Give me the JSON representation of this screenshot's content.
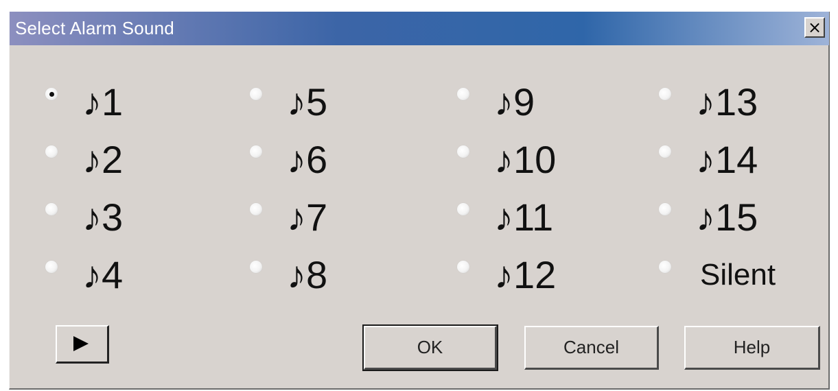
{
  "window": {
    "title": "Select Alarm Sound",
    "close_label": "×"
  },
  "options": [
    {
      "label": "♪1",
      "selected": true
    },
    {
      "label": "♪2",
      "selected": false
    },
    {
      "label": "♪3",
      "selected": false
    },
    {
      "label": "♪4",
      "selected": false
    },
    {
      "label": "♪5",
      "selected": false
    },
    {
      "label": "♪6",
      "selected": false
    },
    {
      "label": "♪7",
      "selected": false
    },
    {
      "label": "♪8",
      "selected": false
    },
    {
      "label": "♪9",
      "selected": false
    },
    {
      "label": "♪10",
      "selected": false
    },
    {
      "label": "♪11",
      "selected": false
    },
    {
      "label": "♪12",
      "selected": false
    },
    {
      "label": "♪13",
      "selected": false
    },
    {
      "label": "♪14",
      "selected": false
    },
    {
      "label": "♪15",
      "selected": false
    },
    {
      "label": "Silent",
      "selected": false
    }
  ],
  "buttons": {
    "play_icon": "play-icon",
    "ok_label": "OK",
    "cancel_label": "Cancel",
    "help_label": "Help"
  },
  "colors": {
    "dialog_bg": "#d8d3cf",
    "titlebar_start": "#8c8fbf",
    "titlebar_mid": "#2f66a9",
    "title_text": "#ffffff"
  }
}
